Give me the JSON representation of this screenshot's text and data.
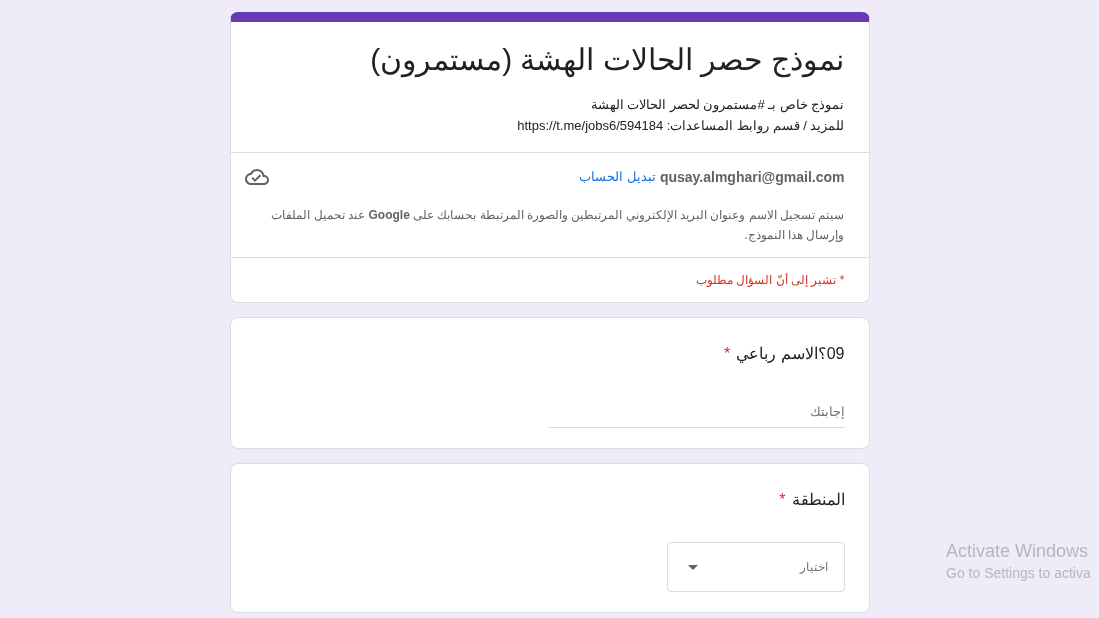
{
  "form": {
    "title": "نموذج حصر الحالات الهشة (مستمرون)",
    "description": [
      "نموذج خاص بـ #مستمرون لحصر الحالات الهشة",
      "للمزيد / قسم روابط المساعدات: https://t.me/jobs6/594184"
    ],
    "account": {
      "email": "qusay.almghari@gmail.com",
      "switch_link": "تبديل الحساب"
    },
    "notice": "سيتم تسجيل الاسم وعنوان البريد الإلكتروني المرتبطين والصورة المرتبطة بحسابك على **Google** عند تحميل الملفات وإرسال هذا النموذج.",
    "required_note": {
      "asterisk": "*",
      "text": "تشير إلى أنّ السؤال مطلوب"
    }
  },
  "questions": [
    {
      "kind": "text",
      "title": "09؟الاسم رباعي",
      "required": true,
      "asterisk": "*",
      "placeholder": "إجابتك"
    },
    {
      "kind": "dropdown",
      "title": "المنطقة",
      "required": true,
      "asterisk": "*",
      "placeholder": "اختيار"
    }
  ],
  "os_overlay": {
    "title": "Activate Windows",
    "subtitle": "Go to Settings to activa"
  }
}
